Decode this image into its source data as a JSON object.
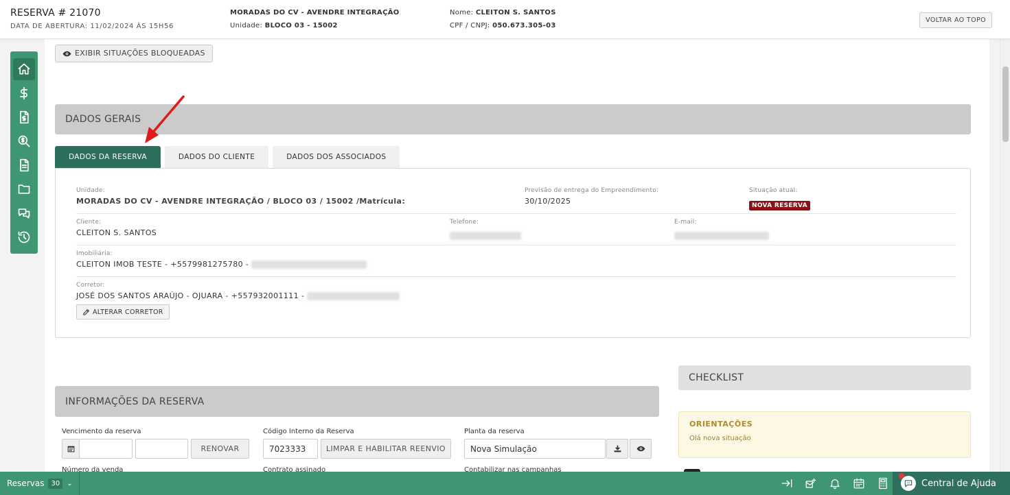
{
  "header": {
    "title": "RESERVA # 21070",
    "opening_label": "DATA DE ABERTURA: 11/02/2024 ÀS 15H56",
    "enterprise": "MORADAS DO CV - AVENDRE INTEGRAÇÃO",
    "unit_label": "Unidade:",
    "unit_value": "BLOCO 03 - 15002",
    "name_label": "Nome:",
    "name_value": "CLEITON S. SANTOS",
    "doc_label": "CPF / CNPJ:",
    "doc_value": "050.673.305-03",
    "back_to_top": "VOLTAR AO TOPO"
  },
  "sidebar": {
    "items": [
      {
        "icon": "home-icon"
      },
      {
        "icon": "dollar-icon"
      },
      {
        "icon": "invoice-icon"
      },
      {
        "icon": "search-money-icon"
      },
      {
        "icon": "document-icon"
      },
      {
        "icon": "folder-icon"
      },
      {
        "icon": "chat-icon"
      },
      {
        "icon": "history-icon"
      }
    ]
  },
  "main": {
    "blocked_button": "EXIBIR SITUAÇÕES BLOQUEADAS",
    "general_title": "DADOS GERAIS",
    "tabs": [
      "DADOS DA RESERVA",
      "DADOS DO CLIENTE",
      "DADOS DOS ASSOCIADOS"
    ],
    "fields": {
      "unit_label": "Unidade:",
      "unit_value": "MORADAS DO CV - AVENDRE INTEGRAÇÃO / BLOCO 03 / 15002 /Matrícula:",
      "delivery_label": "Previsão de entrega do Empreendimento:",
      "delivery_value": "30/10/2025",
      "status_label": "Situação atual:",
      "status_value": "NOVA RESERVA",
      "client_label": "Cliente:",
      "client_value": "CLEITON S. SANTOS",
      "phone_label": "Telefone:",
      "email_label": "E-mail:",
      "agency_label": "Imobiliária:",
      "agency_value": "CLEITON IMOB TESTE - +5579981275780 -",
      "broker_label": "Corretor:",
      "broker_value": "JOSÉ DOS SANTOS ARAÚJO - OJUARA - +557932001111 -",
      "change_broker": "ALTERAR CORRETOR"
    },
    "reservation_info_title": "INFORMAÇÕES DA RESERVA",
    "checklist_title": "CHECKLIST",
    "orientations_title": "ORIENTAÇÕES",
    "orientations_text": "Olá nova situação",
    "form": {
      "due_label": "Vencimento da reserva",
      "renew_button": "RENOVAR",
      "internal_code_label": "Código Interno da Reserva",
      "internal_code_value": "7023333",
      "clear_button": "LIMPAR E HABILITAR REENVIO",
      "plan_label": "Planta da reserva",
      "plan_value": "Nova Simulação",
      "sale_number_label": "Número da venda",
      "signed_contract_label": "Contrato assinado",
      "campaigns_label": "Contabilizar nas campanhas"
    }
  },
  "bottombar": {
    "reservations_label": "Reservas",
    "reservations_count": "30",
    "help_label": "Central de Ajuda"
  },
  "colors": {
    "brand_green": "#3f9673",
    "tab_active": "#2e6e5c",
    "status_badge": "#8b1117",
    "arrow_red": "#e01b1b"
  }
}
